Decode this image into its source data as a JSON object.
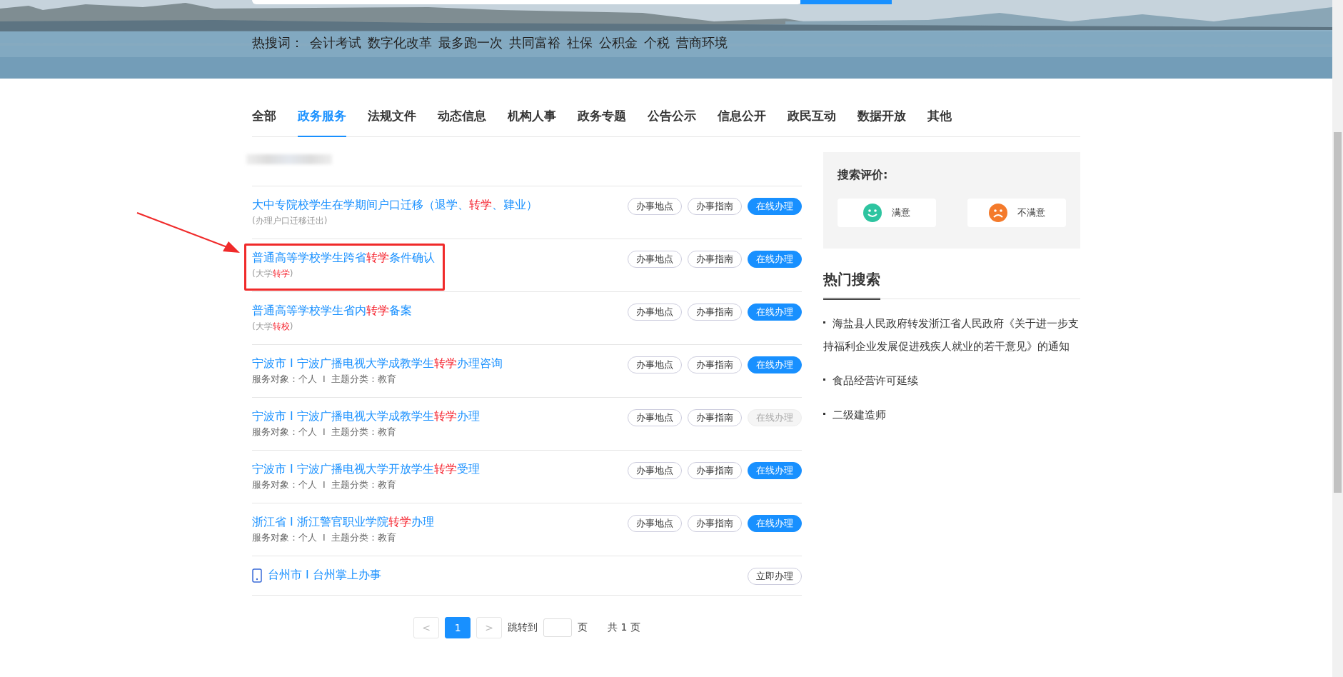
{
  "hot_search": {
    "label": "热搜词：",
    "words": [
      "会计考试",
      "数字化改革",
      "最多跑一次",
      "共同富裕",
      "社保",
      "公积金",
      "个税",
      "营商环境"
    ]
  },
  "tabs": [
    {
      "label": "全部",
      "selected": false
    },
    {
      "label": "政务服务",
      "selected": true
    },
    {
      "label": "法规文件",
      "selected": false
    },
    {
      "label": "动态信息",
      "selected": false
    },
    {
      "label": "机构人事",
      "selected": false
    },
    {
      "label": "政务专题",
      "selected": false
    },
    {
      "label": "公告公示",
      "selected": false
    },
    {
      "label": "信息公开",
      "selected": false
    },
    {
      "label": "政民互动",
      "selected": false
    },
    {
      "label": "数据开放",
      "selected": false
    },
    {
      "label": "其他",
      "selected": false
    }
  ],
  "results": [
    {
      "kind": "service",
      "annotated": false,
      "title": [
        {
          "text": "大中专院校学生在学期间户口迁移（退学、",
          "highlight": false
        },
        {
          "text": "转学",
          "highlight": true
        },
        {
          "text": "、肄业）",
          "highlight": false
        }
      ],
      "subtitle": [
        {
          "text": "(办理户口迁移迁出)",
          "highlight": false
        }
      ],
      "buttons": [
        {
          "label": "办事地点",
          "primary": false,
          "disabled": false
        },
        {
          "label": "办事指南",
          "primary": false,
          "disabled": false
        },
        {
          "label": "在线办理",
          "primary": true,
          "disabled": false
        }
      ]
    },
    {
      "kind": "service",
      "annotated": true,
      "title": [
        {
          "text": "普通高等学校学生跨省",
          "highlight": false
        },
        {
          "text": "转学",
          "highlight": true
        },
        {
          "text": "条件确认",
          "highlight": false
        }
      ],
      "subtitle": [
        {
          "text": "(大学",
          "highlight": false
        },
        {
          "text": "转学",
          "highlight": true
        },
        {
          "text": ")",
          "highlight": false
        }
      ],
      "buttons": [
        {
          "label": "办事地点",
          "primary": false,
          "disabled": false
        },
        {
          "label": "办事指南",
          "primary": false,
          "disabled": false
        },
        {
          "label": "在线办理",
          "primary": true,
          "disabled": false
        }
      ]
    },
    {
      "kind": "service",
      "annotated": false,
      "title": [
        {
          "text": "普通高等学校学生省内",
          "highlight": false
        },
        {
          "text": "转学",
          "highlight": true
        },
        {
          "text": "备案",
          "highlight": false
        }
      ],
      "subtitle": [
        {
          "text": "(大学",
          "highlight": false
        },
        {
          "text": "转校",
          "highlight": true
        },
        {
          "text": ")",
          "highlight": false
        }
      ],
      "buttons": [
        {
          "label": "办事地点",
          "primary": false,
          "disabled": false
        },
        {
          "label": "办事指南",
          "primary": false,
          "disabled": false
        },
        {
          "label": "在线办理",
          "primary": true,
          "disabled": false
        }
      ]
    },
    {
      "kind": "service",
      "annotated": false,
      "title": [
        {
          "text": "宁波市 I 宁波广播电视大学成教学生",
          "highlight": false
        },
        {
          "text": "转学",
          "highlight": true
        },
        {
          "text": "办理咨询",
          "highlight": false
        }
      ],
      "meta": "服务对象：个人  I  主题分类：教育",
      "buttons": [
        {
          "label": "办事地点",
          "primary": false,
          "disabled": false
        },
        {
          "label": "办事指南",
          "primary": false,
          "disabled": false
        },
        {
          "label": "在线办理",
          "primary": true,
          "disabled": false
        }
      ]
    },
    {
      "kind": "service",
      "annotated": false,
      "title": [
        {
          "text": "宁波市 I 宁波广播电视大学成教学生",
          "highlight": false
        },
        {
          "text": "转学",
          "highlight": true
        },
        {
          "text": "办理",
          "highlight": false
        }
      ],
      "meta": "服务对象：个人  I  主题分类：教育",
      "buttons": [
        {
          "label": "办事地点",
          "primary": false,
          "disabled": false
        },
        {
          "label": "办事指南",
          "primary": false,
          "disabled": false
        },
        {
          "label": "在线办理",
          "primary": true,
          "disabled": true
        }
      ]
    },
    {
      "kind": "service",
      "annotated": false,
      "title": [
        {
          "text": "宁波市 I 宁波广播电视大学开放学生",
          "highlight": false
        },
        {
          "text": "转学",
          "highlight": true
        },
        {
          "text": "受理",
          "highlight": false
        }
      ],
      "meta": "服务对象：个人  I  主题分类：教育",
      "buttons": [
        {
          "label": "办事地点",
          "primary": false,
          "disabled": false
        },
        {
          "label": "办事指南",
          "primary": false,
          "disabled": false
        },
        {
          "label": "在线办理",
          "primary": true,
          "disabled": false
        }
      ]
    },
    {
      "kind": "service",
      "annotated": false,
      "title": [
        {
          "text": "浙江省 I 浙江警官职业学院",
          "highlight": false
        },
        {
          "text": "转学",
          "highlight": true
        },
        {
          "text": "办理",
          "highlight": false
        }
      ],
      "meta": "服务对象：个人  I  主题分类：教育",
      "buttons": [
        {
          "label": "办事地点",
          "primary": false,
          "disabled": false
        },
        {
          "label": "办事指南",
          "primary": false,
          "disabled": false
        },
        {
          "label": "在线办理",
          "primary": true,
          "disabled": false
        }
      ]
    },
    {
      "kind": "app",
      "annotated": false,
      "title": [
        {
          "text": "台州市 I 台州掌上办事",
          "highlight": false
        }
      ],
      "buttons": [
        {
          "label": "立即办理",
          "primary": false,
          "disabled": false
        }
      ]
    }
  ],
  "pagination": {
    "prev": "<",
    "pages": [
      {
        "label": "1",
        "selected": true
      }
    ],
    "next": ">",
    "jump_label": "跳转到",
    "page_unit": "页",
    "total": "共 1 页"
  },
  "rating": {
    "title": "搜索评价:",
    "options": [
      {
        "kind": "happy",
        "label": "满意"
      },
      {
        "kind": "sad",
        "label": "不满意"
      }
    ]
  },
  "hot_topics": {
    "title": "热门搜索",
    "items": [
      "海盐县人民政府转发浙江省人民政府《关于进一步支持福利企业发展促进残疾人就业的若干意见》的通知",
      "食品经营许可延续",
      "二级建造师"
    ]
  }
}
